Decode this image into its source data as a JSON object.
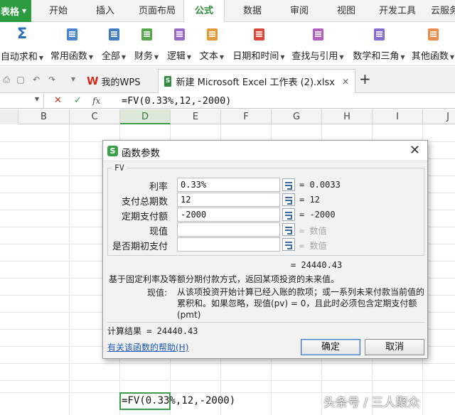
{
  "ribbon_tabs": {
    "app_menu": "表格",
    "items": [
      "开始",
      "插入",
      "页面布局",
      "公式",
      "数据",
      "审阅",
      "视图",
      "开发工具",
      "云服务"
    ]
  },
  "ribbon_buttons": [
    {
      "label": "自动求和",
      "icon": "sigma-icon"
    },
    {
      "label": "常用函数",
      "icon": "star-fx-icon"
    },
    {
      "label": "全部",
      "icon": "list-fx-icon"
    },
    {
      "label": "财务",
      "icon": "money-fx-icon"
    },
    {
      "label": "逻辑",
      "icon": "question-fx-icon"
    },
    {
      "label": "文本",
      "icon": "text-fx-icon"
    },
    {
      "label": "日期和时间",
      "icon": "clock-fx-icon"
    },
    {
      "label": "查找与引用",
      "icon": "search-fx-icon"
    },
    {
      "label": "数学和三角",
      "icon": "theta-fx-icon"
    },
    {
      "label": "其他函数",
      "icon": "more-fx-icon"
    }
  ],
  "doc_tabs": {
    "wps_home": "我的WPS",
    "file": "新建 Microsoft Excel 工作表 (2).xlsx"
  },
  "formula_bar": {
    "fx_label": "fx",
    "formula": "=FV(0.33%,12,-2000)"
  },
  "columns": [
    "B",
    "C",
    "D",
    "E",
    "F",
    "G",
    "H",
    "I",
    "J"
  ],
  "selected_column": "D",
  "cell_content": "=FV(0.33%,12,-2000)",
  "dialog": {
    "title": "函数参数",
    "function_name": "FV",
    "args": [
      {
        "label": "利率",
        "value": "0.33%",
        "result": "= 0.0033",
        "empty": false
      },
      {
        "label": "支付总期数",
        "value": "12",
        "result": "= 12",
        "empty": false
      },
      {
        "label": "定期支付额",
        "value": "-2000",
        "result": "= -2000",
        "empty": false
      },
      {
        "label": "现值",
        "value": "",
        "result": "= 数值",
        "empty": true
      },
      {
        "label": "是否期初支付",
        "value": "",
        "result": "= 数值",
        "empty": true
      }
    ],
    "total_preview": "= 24440.43",
    "function_description": "基于固定利率及等额分期付款方式，返回某项投资的未来值。",
    "arg_desc_label": "现值:",
    "arg_description": "从该项投资开始计算已经入账的款项；或一系列未来付款当前值的累积和。如果忽略，现值(pv) = 0，且此时必须包含定期支付额(pmt)",
    "calc_result": "计算结果 = 24440.43",
    "help_link": "有关该函数的帮助(H)",
    "ok_label": "确定",
    "cancel_label": "取消"
  },
  "watermark": "头条号 / 三人聚众",
  "colors": {
    "accent_green": "#2d9b3f",
    "link_blue": "#1a57b8"
  }
}
